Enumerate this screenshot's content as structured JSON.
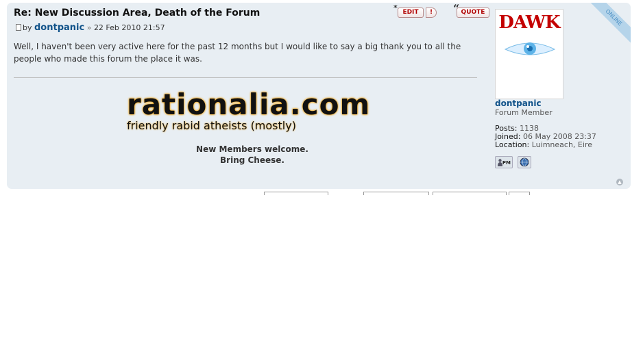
{
  "post": {
    "title": "Re: New Discussion Area, Death of the Forum",
    "by_prefix": "by",
    "author": "dontpanic",
    "separator": "»",
    "date": "22 Feb 2010 21:57",
    "content": "Well, I haven't been very active here for the past 12 months but I would like to say a big thank you to all the people who made this forum the place it was.",
    "actions": {
      "edit_label": "EDIT",
      "report_label": "!",
      "quote_label": "QUOTE"
    },
    "online_label": "ONLINE"
  },
  "signature": {
    "site": "rationalia.com",
    "tagline": "friendly rabid atheists (mostly)",
    "line1": "New Members welcome.",
    "line2": "Bring Cheese."
  },
  "profile": {
    "avatar_text": "DAWK",
    "name": "dontpanic",
    "rank": "Forum Member",
    "posts_label": "Posts:",
    "posts_value": "1138",
    "joined_label": "Joined:",
    "joined_value": "06 May 2008 23:37",
    "location_label": "Location:",
    "location_value": "Luimneach, Eire",
    "pm_label": "PM"
  },
  "colors": {
    "post_background": "#e8eef3",
    "link_blue": "#105289",
    "button_red": "#b00000",
    "banner_glow": "#f4a000",
    "online_ribbon": "#b5d4ea"
  }
}
